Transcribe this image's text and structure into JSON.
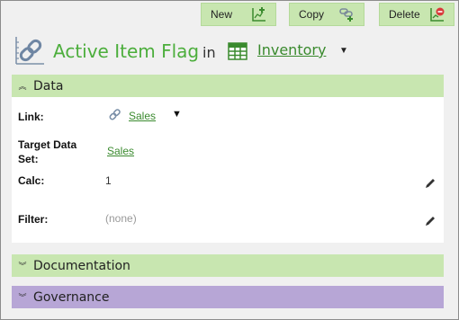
{
  "toolbar": {
    "new_label": "New",
    "copy_label": "Copy",
    "delete_label": "Delete"
  },
  "header": {
    "title": "Active Item Flag",
    "in_label": "in",
    "dataset_link": "Inventory"
  },
  "sections": {
    "data": "Data",
    "documentation": "Documentation",
    "governance": "Governance"
  },
  "fields": {
    "link_label": "Link:",
    "link_value": "Sales",
    "target_label": "Target Data Set:",
    "target_value": "Sales",
    "calc_label": "Calc:",
    "calc_value": "1",
    "filter_label": "Filter:",
    "filter_value": "(none)"
  },
  "colors": {
    "accent_green": "#4cae3c",
    "link_green": "#3a8a2e",
    "section_green": "#c8e6b0",
    "section_purple": "#b7a6d6"
  },
  "icons": {
    "title": "chain-link-icon",
    "dataset": "table-grid-icon",
    "new": "add-chart-icon",
    "copy": "copy-link-icon",
    "delete": "delete-chart-icon",
    "edit": "pencil-icon"
  }
}
